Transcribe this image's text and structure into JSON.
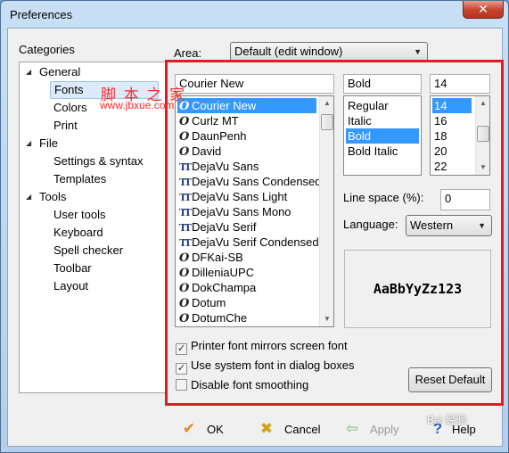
{
  "window": {
    "title": "Preferences",
    "close_label": "✕"
  },
  "categories": {
    "label": "Categories",
    "items": [
      {
        "label": "General",
        "level": 0,
        "expanded": true
      },
      {
        "label": "Fonts",
        "level": 1,
        "selected": true
      },
      {
        "label": "Colors",
        "level": 1
      },
      {
        "label": "Print",
        "level": 1
      },
      {
        "label": "File",
        "level": 0,
        "expanded": true
      },
      {
        "label": "Settings & syntax",
        "level": 1
      },
      {
        "label": "Templates",
        "level": 1
      },
      {
        "label": "Tools",
        "level": 0,
        "expanded": true
      },
      {
        "label": "User tools",
        "level": 1
      },
      {
        "label": "Keyboard",
        "level": 1
      },
      {
        "label": "Spell checker",
        "level": 1
      },
      {
        "label": "Toolbar",
        "level": 1
      },
      {
        "label": "Layout",
        "level": 1
      }
    ]
  },
  "area": {
    "label": "Area:",
    "value": "Default (edit window)"
  },
  "font": {
    "name_value": "Courier New",
    "list": [
      {
        "name": "Courier New",
        "icon": "O",
        "selected": true
      },
      {
        "name": "Curlz MT",
        "icon": "O"
      },
      {
        "name": "DaunPenh",
        "icon": "O"
      },
      {
        "name": "David",
        "icon": "O"
      },
      {
        "name": "DejaVu Sans",
        "icon": "TT"
      },
      {
        "name": "DejaVu Sans Condensed",
        "icon": "TT"
      },
      {
        "name": "DejaVu Sans Light",
        "icon": "TT"
      },
      {
        "name": "DejaVu Sans Mono",
        "icon": "TT"
      },
      {
        "name": "DejaVu Serif",
        "icon": "TT"
      },
      {
        "name": "DejaVu Serif Condensed",
        "icon": "TT"
      },
      {
        "name": "DFKai-SB",
        "icon": "O"
      },
      {
        "name": "DilleniaUPC",
        "icon": "O"
      },
      {
        "name": "DokChampa",
        "icon": "O"
      },
      {
        "name": "Dotum",
        "icon": "O"
      },
      {
        "name": "DotumChe",
        "icon": "O"
      }
    ]
  },
  "style": {
    "value": "Bold",
    "list": [
      {
        "name": "Regular"
      },
      {
        "name": "Italic"
      },
      {
        "name": "Bold",
        "selected": true
      },
      {
        "name": "Bold Italic"
      }
    ]
  },
  "size": {
    "value": "14",
    "list": [
      {
        "name": "14",
        "selected": true
      },
      {
        "name": "16"
      },
      {
        "name": "18"
      },
      {
        "name": "20"
      },
      {
        "name": "22"
      }
    ]
  },
  "line_space": {
    "label": "Line space (%):",
    "value": "0"
  },
  "language": {
    "label": "Language:",
    "value": "Western"
  },
  "preview_text": "AaBbYyZz123",
  "options": [
    {
      "label": "Printer font mirrors screen font",
      "checked": true
    },
    {
      "label": "Use system font in dialog boxes",
      "checked": true
    },
    {
      "label": "Disable font smoothing",
      "checked": false
    }
  ],
  "reset_label": "Reset Default",
  "buttons": {
    "ok": "OK",
    "cancel": "Cancel",
    "apply": "Apply",
    "help": "Help"
  },
  "watermark": {
    "line1": "脚 本 之 家",
    "line2": "www.jbxue.com",
    "badge": "Bai 经验"
  },
  "colors": {
    "highlight": "#e01b24",
    "selection": "#3399ff",
    "ok_check": "#e8861a",
    "cancel_x": "#d4a017"
  }
}
